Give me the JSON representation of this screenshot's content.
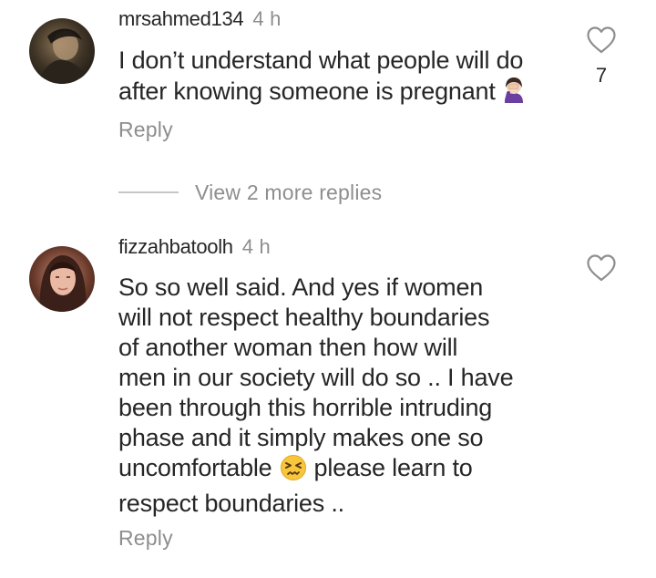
{
  "comments": [
    {
      "username": "mrsahmed134",
      "time": "4 h",
      "lines": [
        "I don’t understand what people will do",
        "after knowing someone is pregnant"
      ],
      "emoji": "facepalm-woman-emoji",
      "reply_label": "Reply",
      "likes": "7"
    },
    {
      "username": "fizzahbatoolh",
      "time": "4 h",
      "lines": [
        "So so well said. And yes if women",
        "will not respect healthy boundaries",
        "of another woman then how will",
        "men in our society will do so .. I have",
        "been through this horrible intruding",
        "phase and it simply makes one so",
        "uncomfortable",
        "respect boundaries .."
      ],
      "line7_after_emoji": "please learn to",
      "emoji": "persevering-face-emoji",
      "reply_label": "Reply"
    }
  ],
  "view_more_replies": "View 2 more replies",
  "colors": {
    "text": "#262626",
    "secondary": "#8e8e8e",
    "divider": "#c7c7c7"
  },
  "icons": [
    "heart-outline-icon"
  ]
}
